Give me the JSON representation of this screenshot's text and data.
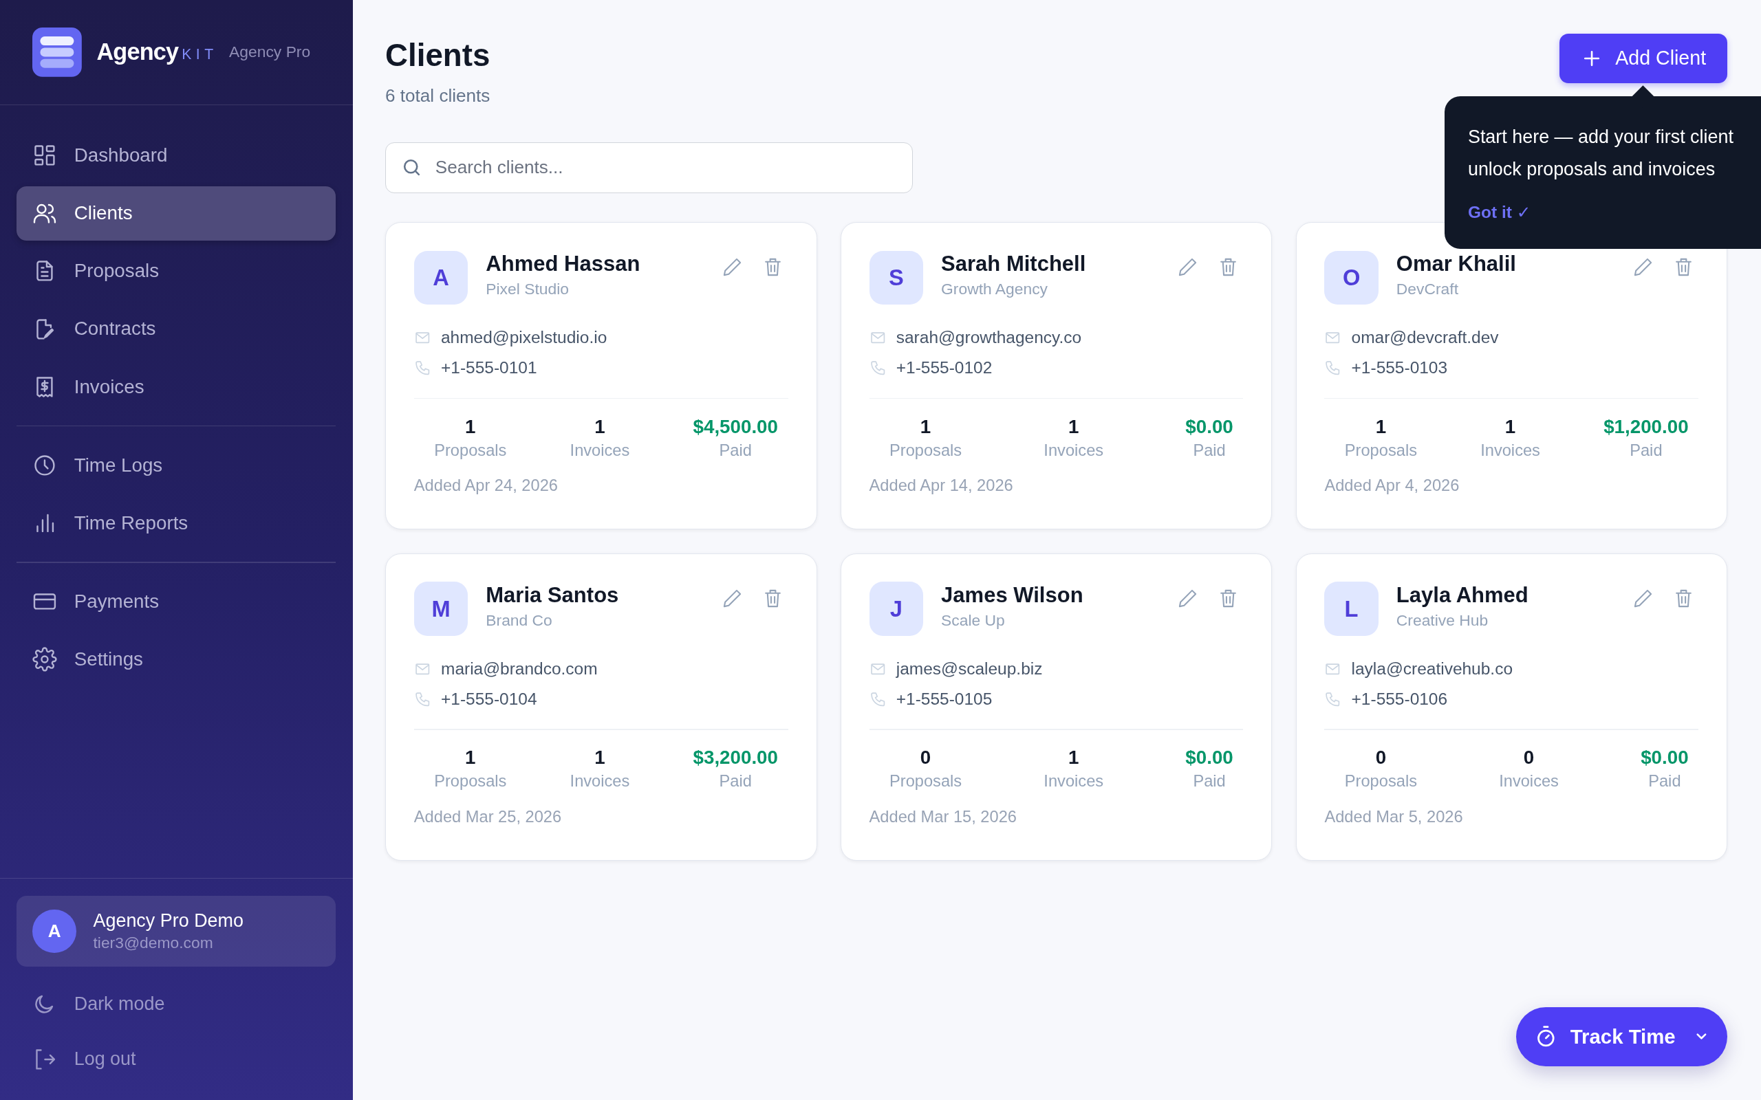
{
  "brand": {
    "name": "Agency",
    "suffix": "KIT",
    "plan": "Agency Pro"
  },
  "sidebar": {
    "groups": [
      [
        {
          "label": "Dashboard",
          "selected": false
        },
        {
          "label": "Clients",
          "selected": true
        },
        {
          "label": "Proposals",
          "selected": false
        },
        {
          "label": "Contracts",
          "selected": false
        },
        {
          "label": "Invoices",
          "selected": false
        }
      ],
      [
        {
          "label": "Time Logs",
          "selected": false
        },
        {
          "label": "Time Reports",
          "selected": false
        }
      ],
      [
        {
          "label": "Payments",
          "selected": false
        },
        {
          "label": "Settings",
          "selected": false
        }
      ]
    ],
    "user": {
      "initial": "A",
      "name": "Agency Pro Demo",
      "email": "tier3@demo.com"
    },
    "footer": [
      "Dark mode",
      "Log out"
    ]
  },
  "page": {
    "title": "Clients",
    "subtitle": "6 total clients",
    "add_button": "Add Client"
  },
  "search": {
    "placeholder": "Search clients..."
  },
  "tooltip": {
    "lines": [
      "Start here — add your first client",
      "unlock proposals and invoices"
    ],
    "action": "Got it ✓"
  },
  "clients": [
    {
      "initial": "A",
      "name": "Ahmed Hassan",
      "company": "Pixel Studio",
      "email": "ahmed@pixelstudio.io",
      "phone": "+1-555-0101",
      "stats": [
        {
          "value": "1",
          "label": "Proposals"
        },
        {
          "value": "1",
          "label": "Invoices"
        },
        {
          "value": "$4,500.00",
          "label": "Paid"
        }
      ],
      "added": "Added Apr 24, 2026"
    },
    {
      "initial": "S",
      "name": "Sarah Mitchell",
      "company": "Growth Agency",
      "email": "sarah@growthagency.co",
      "phone": "+1-555-0102",
      "stats": [
        {
          "value": "1",
          "label": "Proposals"
        },
        {
          "value": "1",
          "label": "Invoices"
        },
        {
          "value": "$0.00",
          "label": "Paid"
        }
      ],
      "added": "Added Apr 14, 2026"
    },
    {
      "initial": "O",
      "name": "Omar Khalil",
      "company": "DevCraft",
      "email": "omar@devcraft.dev",
      "phone": "+1-555-0103",
      "stats": [
        {
          "value": "1",
          "label": "Proposals"
        },
        {
          "value": "1",
          "label": "Invoices"
        },
        {
          "value": "$1,200.00",
          "label": "Paid"
        }
      ],
      "added": "Added Apr 4, 2026"
    },
    {
      "initial": "M",
      "name": "Maria Santos",
      "company": "Brand Co",
      "email": "maria@brandco.com",
      "phone": "+1-555-0104",
      "stats": [
        {
          "value": "1",
          "label": "Proposals"
        },
        {
          "value": "1",
          "label": "Invoices"
        },
        {
          "value": "$3,200.00",
          "label": "Paid"
        }
      ],
      "added": "Added Mar 25, 2026"
    },
    {
      "initial": "J",
      "name": "James Wilson",
      "company": "Scale Up",
      "email": "james@scaleup.biz",
      "phone": "+1-555-0105",
      "stats": [
        {
          "value": "0",
          "label": "Proposals"
        },
        {
          "value": "1",
          "label": "Invoices"
        },
        {
          "value": "$0.00",
          "label": "Paid"
        }
      ],
      "added": "Added Mar 15, 2026"
    },
    {
      "initial": "L",
      "name": "Layla Ahmed",
      "company": "Creative Hub",
      "email": "layla@creativehub.co",
      "phone": "+1-555-0106",
      "stats": [
        {
          "value": "0",
          "label": "Proposals"
        },
        {
          "value": "0",
          "label": "Invoices"
        },
        {
          "value": "$0.00",
          "label": "Paid"
        }
      ],
      "added": "Added Mar 5, 2026"
    }
  ],
  "track_button": "Track Time"
}
